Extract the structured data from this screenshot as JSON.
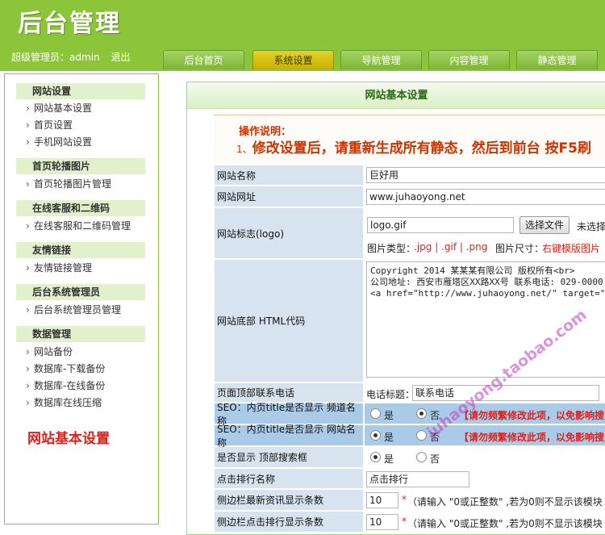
{
  "header": {
    "logo": "后台管理",
    "user": "超级管理员：admin",
    "logout": "退出"
  },
  "nav": {
    "tabs": [
      "后台首页",
      "系统设置",
      "导航管理",
      "内容管理",
      "静态管理"
    ],
    "active": 1
  },
  "sidebar": {
    "groups": [
      {
        "title": "网站设置",
        "items": [
          "网站基本设置",
          "首页设置",
          "手机网站设置"
        ]
      },
      {
        "title": "首页轮播图片",
        "items": [
          "首页轮播图片管理"
        ]
      },
      {
        "title": "在线客服和二维码",
        "items": [
          "在线客服和二维码管理"
        ]
      },
      {
        "title": "友情链接",
        "items": [
          "友情链接管理"
        ]
      },
      {
        "title": "后台系统管理员",
        "items": [
          "后台系统管理员管理"
        ]
      },
      {
        "title": "数据管理",
        "items": [
          "网站备份",
          "数据库-下载备份",
          "数据库-在线备份",
          "数据库在线压缩"
        ]
      }
    ],
    "caption": "网站基本设置"
  },
  "main": {
    "title": "网站基本设置",
    "notice_title": "操作说明：",
    "notice_num": "1、",
    "notice_text": "修改设置后，请重新生成所有静态，然后到前台 按F5刷"
  },
  "form": {
    "site_name": {
      "label": "网站名称",
      "value": "巨好用"
    },
    "site_url": {
      "label": "网站网址",
      "value": "www.juhaoyong.net"
    },
    "logo": {
      "label": "网站标志(logo)",
      "value": "logo.gif",
      "choose_btn": "选择文件",
      "no_file": "未选择",
      "type_label": "图片类型：",
      "types": ".jpg | .gif | .png",
      "size_label": "图片尺寸：",
      "size_value": "右键模版图片"
    },
    "footer": {
      "label": "网站底部 HTML代码",
      "value": "Copyright 2014 某某某有限公司 版权所有<br>\n公司地址: 西安市雁塔区XX路XX号 联系电话: 029-0000\n<a href=\"http://www.juhaoyong.net/\" target=\"_blan"
    },
    "contact": {
      "label": "页面顶部联系电话",
      "prefix": "电话标题：",
      "value": "联系电话"
    },
    "seo_channel": {
      "label": "SEO：内页title是否显示 频道名称",
      "yes": "是",
      "no": "否",
      "selected": "no",
      "warn": "【请勿频繁修改此项，以免影响搜"
    },
    "seo_site": {
      "label": "SEO：内页title是否显示 网站名称",
      "yes": "是",
      "no": "否",
      "selected": "yes",
      "warn": "【请勿频繁修改此项，以免影响搜"
    },
    "top_search": {
      "label": "是否显示 顶部搜索框",
      "yes": "是",
      "no": "否",
      "selected": "yes"
    },
    "click_rank": {
      "label": "点击排行名称",
      "value": "点击排行"
    },
    "side_news": {
      "label": "侧边栏最新资讯显示条数",
      "value": "10",
      "star": "*",
      "hint": "（请输入 \"0或正整数\" ,若为0则不显示该模块"
    },
    "side_click": {
      "label": "侧边栏点击排行显示条数",
      "value": "10",
      "star": "*",
      "hint": "（请输入 \"0或正整数\" ,若为0则不显示该模块"
    }
  },
  "watermark": "juhaoyong.taobao.com"
}
